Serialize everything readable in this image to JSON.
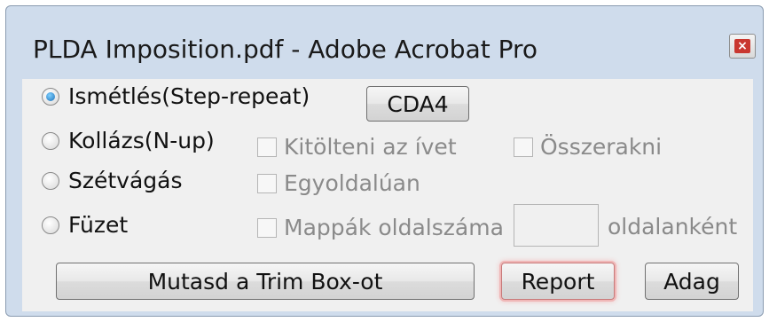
{
  "window": {
    "title": "PLDA Imposition.pdf - Adobe Acrobat Pro",
    "close_icon": "close-icon"
  },
  "modes": [
    {
      "label": "Ismétlés(Step-repeat)",
      "selected": true
    },
    {
      "label": "Kollázs(N-up)",
      "selected": false
    },
    {
      "label": "Szétvágás",
      "selected": false
    },
    {
      "label": "Füzet",
      "selected": false
    }
  ],
  "buttons": {
    "cda4": "CDA4",
    "trim_box": "Mutasd a Trim Box-ot",
    "report": "Report",
    "adag": "Adag"
  },
  "options": {
    "fill_sheet": {
      "label": "Kitölteni az ívet",
      "checked": false,
      "enabled": false
    },
    "combine": {
      "label": "Összerakni",
      "checked": false,
      "enabled": false
    },
    "one_sided": {
      "label": "Egyoldalúan",
      "checked": false,
      "enabled": false
    },
    "folder_pages": {
      "label": "Mappák oldalszáma",
      "checked": false,
      "enabled": false
    }
  },
  "per_page": {
    "value": "",
    "suffix": "oldalanként"
  }
}
